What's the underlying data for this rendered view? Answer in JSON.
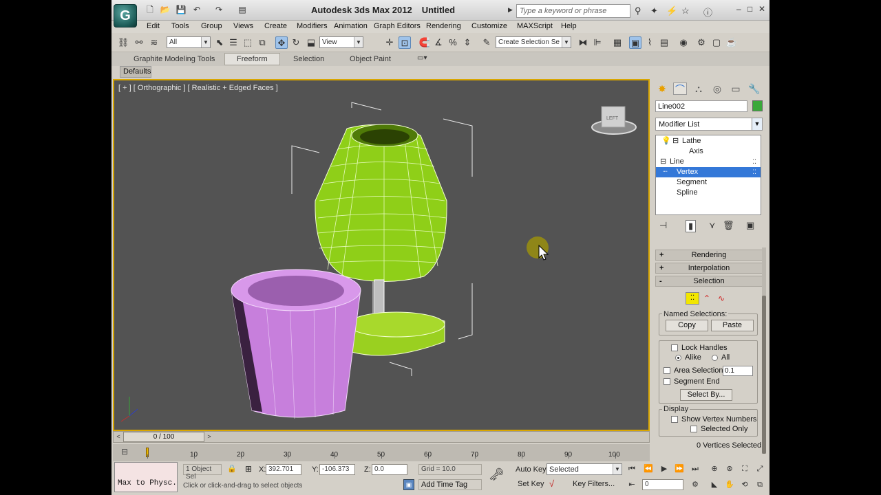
{
  "window": {
    "app": "Autodesk 3ds Max  2012",
    "doc": "Untitled",
    "search_placeholder": "Type a keyword or phrase",
    "logo": "G"
  },
  "menu": [
    "Edit",
    "Tools",
    "Group",
    "Views",
    "Create",
    "Modifiers",
    "Animation",
    "Graph Editors",
    "Rendering",
    "Customize",
    "MAXScript",
    "Help"
  ],
  "toolbar": {
    "filter": "All",
    "refcoord": "View",
    "selset": "Create Selection Se"
  },
  "ribbon": {
    "tabs": [
      "Graphite Modeling Tools",
      "Freeform",
      "Selection",
      "Object Paint"
    ],
    "active": "Freeform",
    "sub": "Defaults"
  },
  "viewport": {
    "label": "[ + ] [ Orthographic ] [ Realistic + Edged Faces ]",
    "viewcube": "LEFT"
  },
  "panel": {
    "obj_name": "Line002",
    "obj_color": "#3aa83a",
    "modifier_list": "Modifier List",
    "stack": [
      "Lathe",
      "Axis",
      "Line",
      "Vertex",
      "Segment",
      "Spline"
    ],
    "selected_stack": "Vertex",
    "rollouts": [
      "Rendering",
      "Interpolation",
      "Selection"
    ],
    "named_sel": "Named Selections:",
    "copy": "Copy",
    "paste": "Paste",
    "lock_handles": "Lock Handles",
    "alike": "Alike",
    "all": "All",
    "area_sel": "Area Selection:",
    "area_val": "0.1",
    "segment_end": "Segment End",
    "select_by": "Select By...",
    "display": "Display",
    "show_vertex": "Show Vertex Numbers",
    "selected_only": "Selected Only",
    "status": "0 Vertices Selected"
  },
  "time": {
    "frame": "0 / 100",
    "ticks": [
      "10",
      "20",
      "30",
      "40",
      "50",
      "60",
      "70",
      "80",
      "90",
      "100"
    ]
  },
  "status": {
    "maxscript": "Max to Physc.",
    "objsel": "1 Object Sel",
    "prompt": "Click or click-and-drag to select objects",
    "x_label": "X:",
    "x": "392.701",
    "y_label": "Y:",
    "y": "-106.373",
    "z_label": "Z:",
    "z": "0.0",
    "grid": "Grid = 10.0",
    "add_time_tag": "Add Time Tag",
    "auto_key": "Auto Key",
    "selected": "Selected",
    "set_key": "Set Key",
    "key_filters": "Key Filters...",
    "frame_field": "0"
  }
}
